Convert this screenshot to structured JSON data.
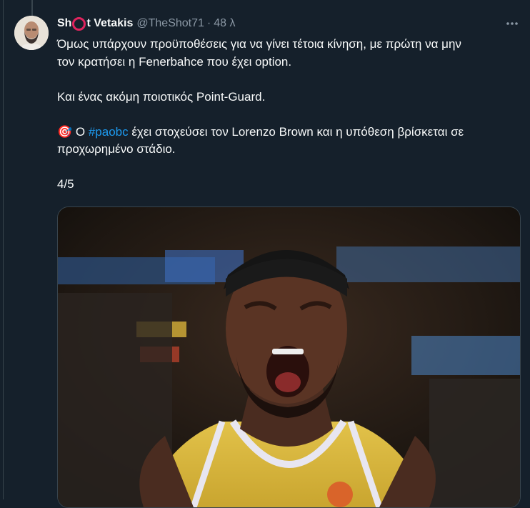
{
  "tweet": {
    "author_name_part1": "Sh",
    "author_name_part2": "t Vetakis",
    "handle": "@TheShot71",
    "separator": "·",
    "time": "48 λ",
    "more_icon": "ellipsis-icon",
    "lines": {
      "l1": "Όμως υπάρχουν προϋποθέσεις για να γίνει τέτοια κίνηση, με πρώτη να μην",
      "l2": "τον κρατήσει η Fenerbahce που έχει option.",
      "l3": "Και ένας ακόμη ποιοτικός Point-Guard.",
      "l4_emoji": "🎯",
      "l4_pre": " Ο ",
      "hashtag": "#paobc",
      "l4_post": " έχει στοχεύσει τον Lorenzo Brown και η υπόθεση βρίσκεται σε",
      "l5": "προχωρημένο στάδιο.",
      "l6": "4/5"
    },
    "accent": "#1d9bf0",
    "media_alt": "basketball-player-photo"
  }
}
